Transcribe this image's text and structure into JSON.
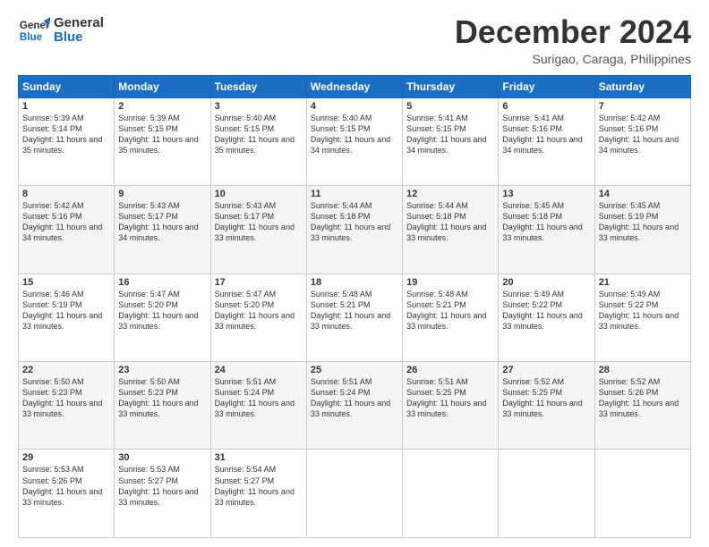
{
  "logo": {
    "line1": "General",
    "line2": "Blue"
  },
  "header": {
    "month": "December 2024",
    "location": "Surigao, Caraga, Philippines"
  },
  "weekdays": [
    "Sunday",
    "Monday",
    "Tuesday",
    "Wednesday",
    "Thursday",
    "Friday",
    "Saturday"
  ],
  "weeks": [
    [
      {
        "day": "1",
        "sunrise": "5:39 AM",
        "sunset": "5:14 PM",
        "daylight": "11 hours and 35 minutes."
      },
      {
        "day": "2",
        "sunrise": "5:39 AM",
        "sunset": "5:15 PM",
        "daylight": "11 hours and 35 minutes."
      },
      {
        "day": "3",
        "sunrise": "5:40 AM",
        "sunset": "5:15 PM",
        "daylight": "11 hours and 35 minutes."
      },
      {
        "day": "4",
        "sunrise": "5:40 AM",
        "sunset": "5:15 PM",
        "daylight": "11 hours and 34 minutes."
      },
      {
        "day": "5",
        "sunrise": "5:41 AM",
        "sunset": "5:15 PM",
        "daylight": "11 hours and 34 minutes."
      },
      {
        "day": "6",
        "sunrise": "5:41 AM",
        "sunset": "5:16 PM",
        "daylight": "11 hours and 34 minutes."
      },
      {
        "day": "7",
        "sunrise": "5:42 AM",
        "sunset": "5:16 PM",
        "daylight": "11 hours and 34 minutes."
      }
    ],
    [
      {
        "day": "8",
        "sunrise": "5:42 AM",
        "sunset": "5:16 PM",
        "daylight": "11 hours and 34 minutes."
      },
      {
        "day": "9",
        "sunrise": "5:43 AM",
        "sunset": "5:17 PM",
        "daylight": "11 hours and 34 minutes."
      },
      {
        "day": "10",
        "sunrise": "5:43 AM",
        "sunset": "5:17 PM",
        "daylight": "11 hours and 33 minutes."
      },
      {
        "day": "11",
        "sunrise": "5:44 AM",
        "sunset": "5:18 PM",
        "daylight": "11 hours and 33 minutes."
      },
      {
        "day": "12",
        "sunrise": "5:44 AM",
        "sunset": "5:18 PM",
        "daylight": "11 hours and 33 minutes."
      },
      {
        "day": "13",
        "sunrise": "5:45 AM",
        "sunset": "5:18 PM",
        "daylight": "11 hours and 33 minutes."
      },
      {
        "day": "14",
        "sunrise": "5:45 AM",
        "sunset": "5:19 PM",
        "daylight": "11 hours and 33 minutes."
      }
    ],
    [
      {
        "day": "15",
        "sunrise": "5:46 AM",
        "sunset": "5:19 PM",
        "daylight": "11 hours and 33 minutes."
      },
      {
        "day": "16",
        "sunrise": "5:47 AM",
        "sunset": "5:20 PM",
        "daylight": "11 hours and 33 minutes."
      },
      {
        "day": "17",
        "sunrise": "5:47 AM",
        "sunset": "5:20 PM",
        "daylight": "11 hours and 33 minutes."
      },
      {
        "day": "18",
        "sunrise": "5:48 AM",
        "sunset": "5:21 PM",
        "daylight": "11 hours and 33 minutes."
      },
      {
        "day": "19",
        "sunrise": "5:48 AM",
        "sunset": "5:21 PM",
        "daylight": "11 hours and 33 minutes."
      },
      {
        "day": "20",
        "sunrise": "5:49 AM",
        "sunset": "5:22 PM",
        "daylight": "11 hours and 33 minutes."
      },
      {
        "day": "21",
        "sunrise": "5:49 AM",
        "sunset": "5:22 PM",
        "daylight": "11 hours and 33 minutes."
      }
    ],
    [
      {
        "day": "22",
        "sunrise": "5:50 AM",
        "sunset": "5:23 PM",
        "daylight": "11 hours and 33 minutes."
      },
      {
        "day": "23",
        "sunrise": "5:50 AM",
        "sunset": "5:23 PM",
        "daylight": "11 hours and 33 minutes."
      },
      {
        "day": "24",
        "sunrise": "5:51 AM",
        "sunset": "5:24 PM",
        "daylight": "11 hours and 33 minutes."
      },
      {
        "day": "25",
        "sunrise": "5:51 AM",
        "sunset": "5:24 PM",
        "daylight": "11 hours and 33 minutes."
      },
      {
        "day": "26",
        "sunrise": "5:51 AM",
        "sunset": "5:25 PM",
        "daylight": "11 hours and 33 minutes."
      },
      {
        "day": "27",
        "sunrise": "5:52 AM",
        "sunset": "5:25 PM",
        "daylight": "11 hours and 33 minutes."
      },
      {
        "day": "28",
        "sunrise": "5:52 AM",
        "sunset": "5:26 PM",
        "daylight": "11 hours and 33 minutes."
      }
    ],
    [
      {
        "day": "29",
        "sunrise": "5:53 AM",
        "sunset": "5:26 PM",
        "daylight": "11 hours and 33 minutes."
      },
      {
        "day": "30",
        "sunrise": "5:53 AM",
        "sunset": "5:27 PM",
        "daylight": "11 hours and 33 minutes."
      },
      {
        "day": "31",
        "sunrise": "5:54 AM",
        "sunset": "5:27 PM",
        "daylight": "11 hours and 33 minutes."
      },
      null,
      null,
      null,
      null
    ]
  ]
}
